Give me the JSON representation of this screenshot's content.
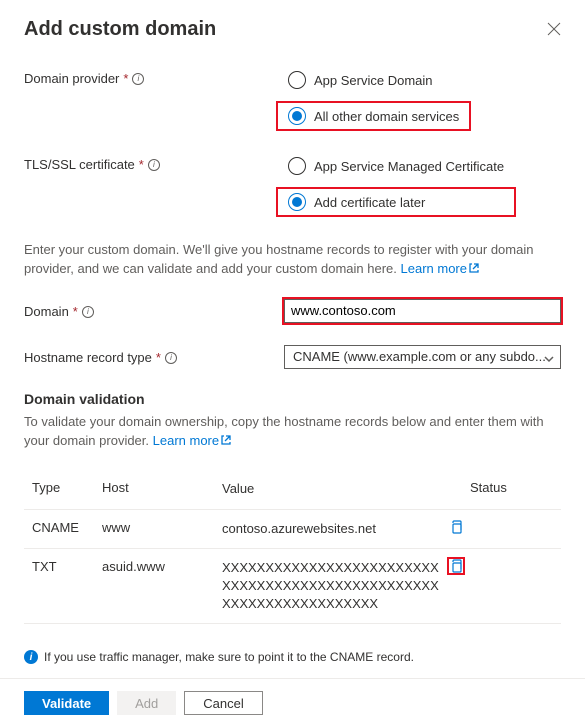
{
  "header": {
    "title": "Add custom domain"
  },
  "domainProvider": {
    "label": "Domain provider",
    "options": {
      "appService": "App Service Domain",
      "allOther": "All other domain services"
    }
  },
  "tlsCert": {
    "label": "TLS/SSL certificate",
    "options": {
      "managed": "App Service Managed Certificate",
      "later": "Add certificate later"
    }
  },
  "customDomainDesc": "Enter your custom domain. We'll give you hostname records to register with your domain provider, and we can validate and add your custom domain here. ",
  "learnMore": "Learn more",
  "domainField": {
    "label": "Domain",
    "value": "www.contoso.com"
  },
  "hostnameRecordType": {
    "label": "Hostname record type",
    "value": "CNAME (www.example.com or any subdo..."
  },
  "validation": {
    "title": "Domain validation",
    "desc": "To validate your domain ownership, copy the hostname records below and enter them with your domain provider. "
  },
  "table": {
    "headers": {
      "type": "Type",
      "host": "Host",
      "value": "Value",
      "status": "Status"
    },
    "rows": [
      {
        "type": "CNAME",
        "host": "www",
        "value": "contoso.azurewebsites.net"
      },
      {
        "type": "TXT",
        "host": "asuid.www",
        "value": "XXXXXXXXXXXXXXXXXXXXXXXXXXXXXXXXXXXXXXXXXXXXXXXXXXXXXXXXXXXXXXXXXXXX"
      }
    ]
  },
  "infoBanner": "If you use traffic manager, make sure to point it to the CNAME record.",
  "footer": {
    "validate": "Validate",
    "add": "Add",
    "cancel": "Cancel"
  }
}
